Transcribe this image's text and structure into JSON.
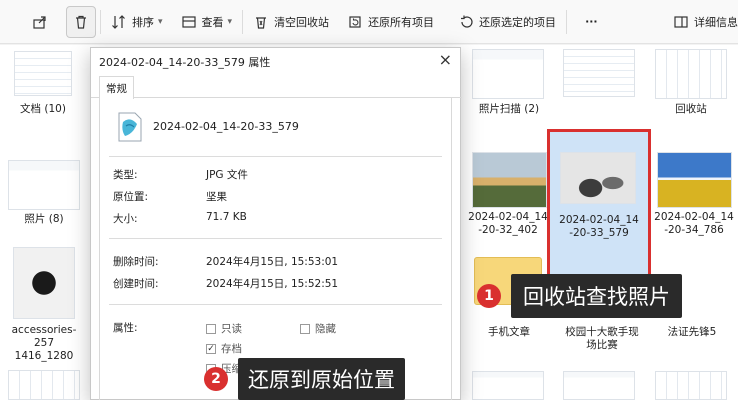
{
  "toolbar": {
    "sort_label": "排序",
    "view_label": "查看",
    "empty_bin_label": "清空回收站",
    "restore_all_label": "还原所有项目",
    "restore_selected_label": "还原选定的项目",
    "more_label": "···",
    "details_label": "详细信息"
  },
  "files": {
    "left": [
      {
        "label": "文档 (10)"
      },
      {
        "label": "照片 (8)"
      },
      {
        "label": "accessories-257\n1416_1280"
      }
    ],
    "right_top": [
      {
        "label": "照片扫描 (2)"
      },
      {
        "label": "回收站"
      }
    ],
    "row2": [
      {
        "label": "2024-02-04_14\n-20-32_402"
      },
      {
        "label": "2024-02-04_14\n-20-33_579"
      },
      {
        "label": "2024-02-04_14\n-20-34_786"
      }
    ],
    "row3": [
      {
        "label": "手机文章"
      },
      {
        "label": "校园十大歌手现\n场比赛"
      },
      {
        "label": "法证先锋5"
      }
    ]
  },
  "dialog": {
    "title": "2024-02-04_14-20-33_579 属性",
    "close": "×",
    "tab": "常规",
    "file_name": "2024-02-04_14-20-33_579",
    "type_label": "类型:",
    "type_value": "JPG 文件",
    "origin_label": "原位置:",
    "origin_value": "坚果",
    "size_label": "大小:",
    "size_value": "71.7 KB",
    "deleted_label": "删除时间:",
    "deleted_value": "2024年4月15日, 15:53:01",
    "created_label": "创建时间:",
    "created_value": "2024年4月15日, 15:52:51",
    "attrs_label": "属性:",
    "attr_readonly": "只读",
    "attr_hidden": "隐藏",
    "attr_archive": "存档",
    "attr_compress": "压缩"
  },
  "callouts": {
    "one_num": "1",
    "one_text": "回收站查找照片",
    "two_num": "2",
    "two_text": "还原到原始位置"
  }
}
